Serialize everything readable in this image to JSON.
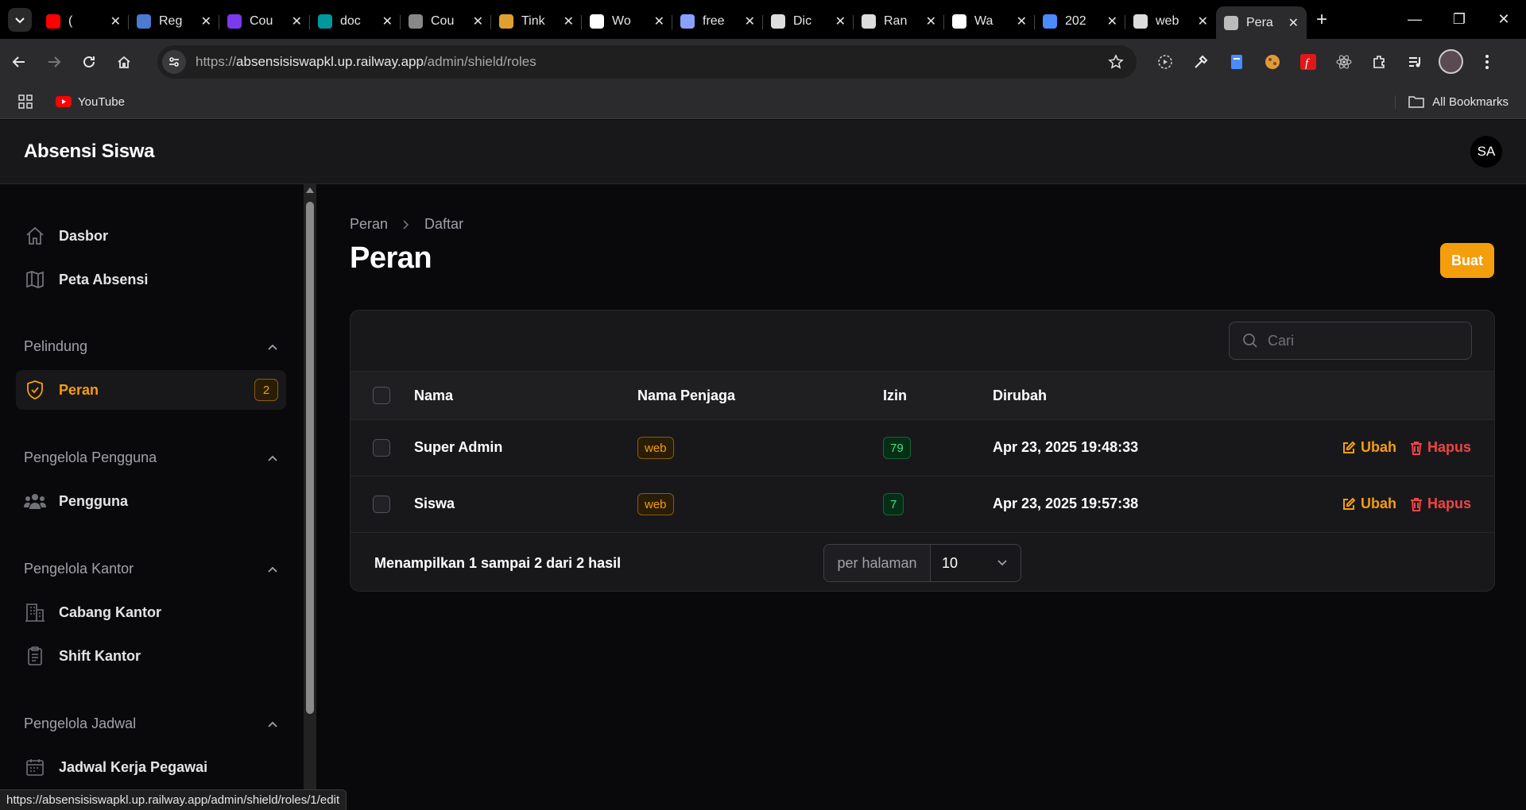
{
  "browser": {
    "tabs": [
      {
        "title": "(",
        "icon": "youtube-icon",
        "color": "#ff0000"
      },
      {
        "title": "Reg",
        "icon": "rocket-icon",
        "color": "#4a7bd0"
      },
      {
        "title": "Cou",
        "icon": "u-icon",
        "color": "#7c3aed"
      },
      {
        "title": "doc",
        "icon": "arduino-icon",
        "color": "#00979d"
      },
      {
        "title": "Cou",
        "icon": "globe-icon",
        "color": "#888888"
      },
      {
        "title": "Tink",
        "icon": "tinkercad-icon",
        "color": "#e0a030"
      },
      {
        "title": "Wo",
        "icon": "wikipedia-icon",
        "color": "#ffffff"
      },
      {
        "title": "free",
        "icon": "code-icon",
        "color": "#8aa0ff"
      },
      {
        "title": "Dic",
        "icon": "g-icon",
        "color": "#dddddd"
      },
      {
        "title": "Ran",
        "icon": "g-icon",
        "color": "#dddddd"
      },
      {
        "title": "Wa",
        "icon": "openai-icon",
        "color": "#ffffff"
      },
      {
        "title": "202",
        "icon": "person-icon",
        "color": "#4a8bff"
      },
      {
        "title": "web",
        "icon": "web-icon",
        "color": "#dddddd"
      },
      {
        "title": "Pera",
        "icon": "globe-icon",
        "color": "#bbbbbb"
      }
    ],
    "url_prefix": "https://",
    "url_host": "absensisiswapkl.up.railway.app",
    "url_path": "/admin/shield/roles",
    "bookmark_youtube": "YouTube",
    "all_bookmarks": "All Bookmarks",
    "status_url": "https://absensisiswapkl.up.railway.app/admin/shield/roles/1/edit"
  },
  "app": {
    "brand": "Absensi Siswa",
    "user_initials": "SA"
  },
  "sidebar": {
    "dasbor": "Dasbor",
    "peta": "Peta Absensi",
    "group_pelindung": "Pelindung",
    "peran": "Peran",
    "peran_count": "2",
    "group_pengguna": "Pengelola Pengguna",
    "pengguna": "Pengguna",
    "group_kantor": "Pengelola Kantor",
    "cabang": "Cabang Kantor",
    "shift": "Shift Kantor",
    "group_jadwal": "Pengelola Jadwal",
    "jadwal": "Jadwal Kerja Pegawai"
  },
  "page": {
    "breadcrumb_root": "Peran",
    "breadcrumb_current": "Daftar",
    "title": "Peran",
    "create_label": "Buat",
    "search_placeholder": "Cari"
  },
  "table": {
    "columns": [
      "Nama",
      "Nama Penjaga",
      "Izin",
      "Dirubah"
    ],
    "rows": [
      {
        "name": "Super Admin",
        "guard": "web",
        "permissions": "79",
        "updated": "Apr 23, 2025 19:48:33"
      },
      {
        "name": "Siswa",
        "guard": "web",
        "permissions": "7",
        "updated": "Apr 23, 2025 19:57:38"
      }
    ],
    "edit_label": "Ubah",
    "delete_label": "Hapus",
    "summary": "Menampilkan 1 sampai 2 dari 2 hasil",
    "per_page_label": "per halaman",
    "per_page_value": "10"
  }
}
